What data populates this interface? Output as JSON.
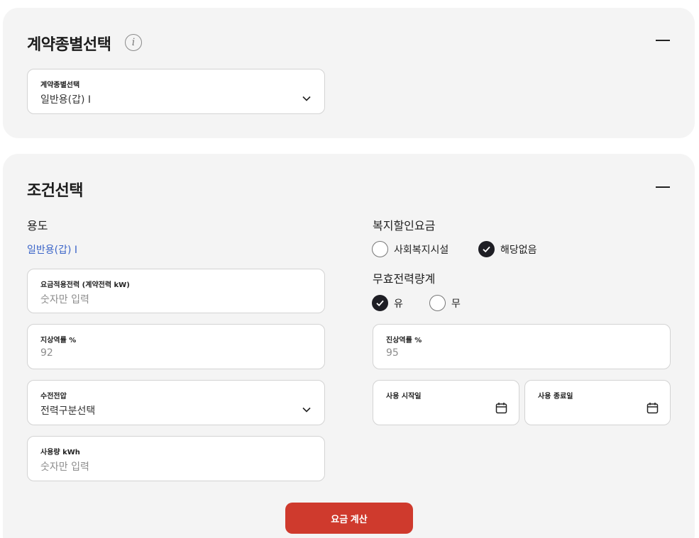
{
  "contract": {
    "title": "계약종별선택",
    "info_icon": "info-icon",
    "field_label": "계약종별선택",
    "field_value": "일반용(갑) I"
  },
  "condition": {
    "title": "조건선택",
    "purpose_label": "용도",
    "purpose_value": "일반용(갑) I",
    "applied_power": {
      "label": "요금적용전력 (계약전력 kW)",
      "placeholder": "숫자만 입력"
    },
    "ground_factor": {
      "label": "지상역률 %",
      "value": "92"
    },
    "voltage": {
      "label": "수전전압",
      "value": "전력구분선택"
    },
    "usage": {
      "label": "사용량 kWh",
      "placeholder": "숫자만 입력"
    },
    "welfare_label": "복지할인요금",
    "welfare_options": [
      {
        "label": "사회복지시설",
        "checked": false
      },
      {
        "label": "해당없음",
        "checked": true
      }
    ],
    "reactive_label": "무효전력량계",
    "reactive_options": [
      {
        "label": "유",
        "checked": true
      },
      {
        "label": "무",
        "checked": false
      }
    ],
    "lead_factor": {
      "label": "진상역률 %",
      "value": "95"
    },
    "start_date": {
      "label": "사용 시작일"
    },
    "end_date": {
      "label": "사용 종료일"
    },
    "calc_button": "요금 계산"
  },
  "colors": {
    "accent": "#cf3a2d",
    "link": "#3a64c8",
    "panel_bg": "#f4f4f4"
  }
}
